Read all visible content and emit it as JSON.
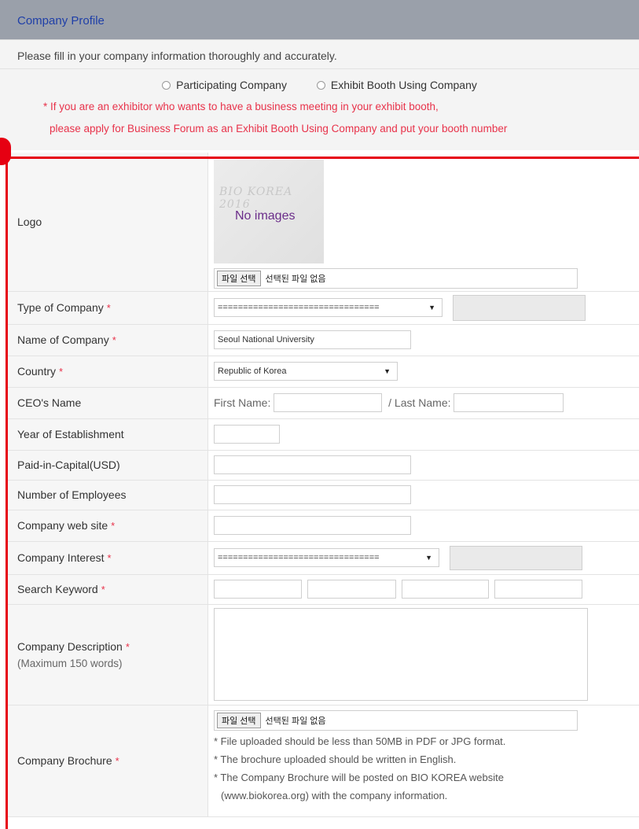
{
  "header": {
    "title": "Company Profile"
  },
  "notice": {
    "instruction": "Please fill in your company information thoroughly and accurately.",
    "radio_participating": "Participating Company",
    "radio_exhibit": "Exhibit Booth Using Company",
    "warning_line1": "* If you are an exhibitor who wants to have a business meeting in your exhibit booth,",
    "warning_line2": "please apply for Business Forum as an Exhibit Booth Using Company and put your booth number"
  },
  "form": {
    "logo": {
      "label": "Logo",
      "watermark": "BIO KOREA 2016",
      "no_image": "No images",
      "file_button": "파일 선택",
      "file_status": "선택된 파일 없음"
    },
    "type_of_company": {
      "label": "Type of Company",
      "required": "*",
      "select_value": "================================",
      "select_arrow": "▼"
    },
    "name_of_company": {
      "label": "Name of Company",
      "required": "*",
      "value": "Seoul National University"
    },
    "country": {
      "label": "Country",
      "required": "*",
      "select_value": "Republic of Korea",
      "select_arrow": "▼"
    },
    "ceo_name": {
      "label": "CEO's Name",
      "first_label": "First Name:",
      "last_label": "/ Last Name:"
    },
    "year_established": {
      "label": "Year of Establishment"
    },
    "paid_in_capital": {
      "label": "Paid-in-Capital(USD)"
    },
    "employees": {
      "label": "Number of Employees"
    },
    "website": {
      "label": "Company web site",
      "required": "*"
    },
    "interest": {
      "label": "Company Interest",
      "required": "*",
      "select_value": "================================",
      "select_arrow": "▼"
    },
    "keyword": {
      "label": "Search Keyword",
      "required": "*"
    },
    "description": {
      "label": "Company Description",
      "required": "*",
      "sublabel": "(Maximum 150 words)"
    },
    "brochure": {
      "label": "Company Brochure",
      "required": "*",
      "file_button": "파일 선택",
      "file_status": "선택된 파일 없음",
      "note1": "* File uploaded should be less than 50MB in PDF or JPG format.",
      "note2": "* The brochure uploaded should be written in English.",
      "note3": "* The Company Brochure will be posted on BIO KOREA website",
      "note4": "(www.biokorea.org) with the company information."
    }
  },
  "annotation": {
    "color": "#e60012"
  }
}
